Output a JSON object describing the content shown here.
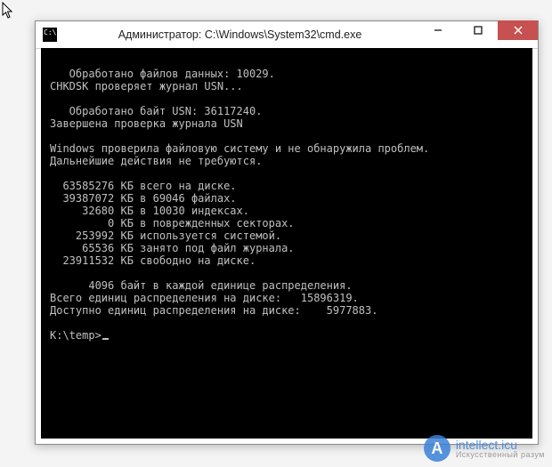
{
  "window": {
    "title": "Администратор: C:\\Windows\\System32\\cmd.exe"
  },
  "console": {
    "lines": [
      "",
      "   Обработано файлов данных: 10029.",
      "CHKDSK проверяет журнал USN...",
      "",
      "   Обработано байт USN: 36117240.",
      "Завершена проверка журнала USN",
      "",
      "Windows проверила файловую систему и не обнаружила проблем.",
      "Дальнейшие действия не требуются.",
      "",
      "  63585276 КБ всего на диске.",
      "  39387072 КБ в 69046 файлах.",
      "     32680 КБ в 10030 индексах.",
      "         0 КБ в поврежденных секторах.",
      "    253992 КБ используется системой.",
      "     65536 КБ занято под файл журнала.",
      "  23911532 КБ свободно на диске.",
      "",
      "      4096 байт в каждой единице распределения.",
      "Всего единиц распределения на диске:   15896319.",
      "Доступно единиц распределения на диске:    5977883.",
      ""
    ],
    "prompt": "K:\\temp>"
  },
  "watermark": {
    "badge": "A",
    "line1": "intellect.icu",
    "line2": "Искусственный разум"
  }
}
